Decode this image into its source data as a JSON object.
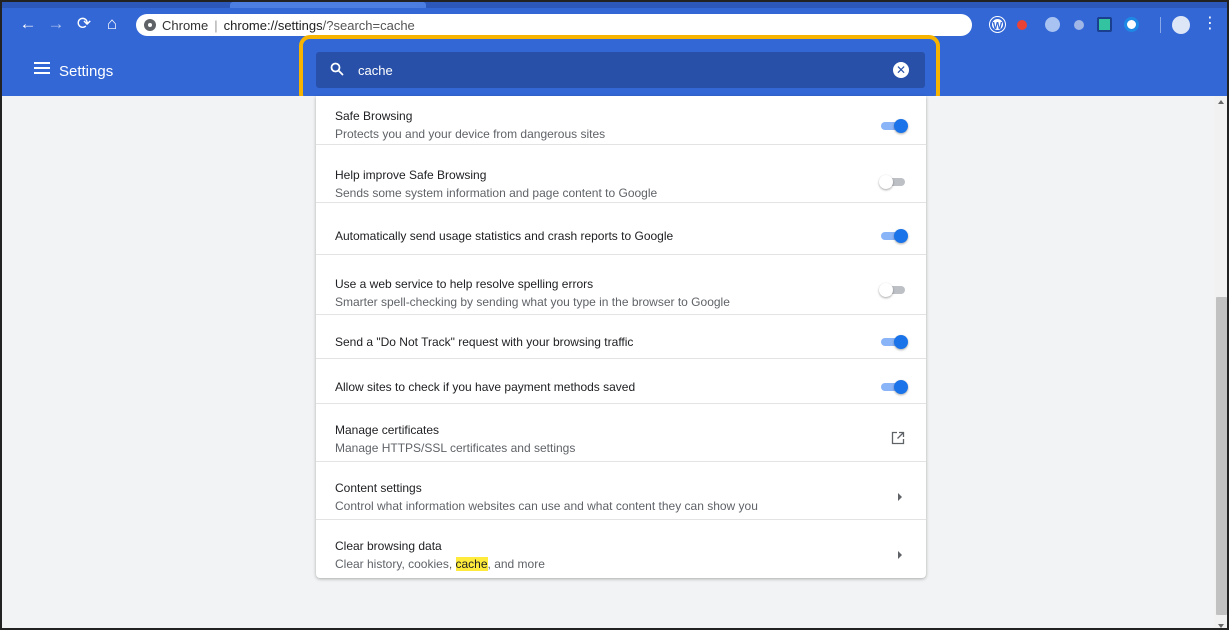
{
  "browser": {
    "omnibox": {
      "site_label": "Chrome",
      "separator": "|",
      "url_scheme_host": "chrome://settings",
      "url_rest": "/?search=cache"
    }
  },
  "header": {
    "title": "Settings"
  },
  "search": {
    "value": "cache"
  },
  "settings": {
    "safe_browsing": {
      "title": "Safe Browsing",
      "subtitle": "Protects you and your device from dangerous sites",
      "enabled": true
    },
    "help_improve": {
      "title": "Help improve Safe Browsing",
      "subtitle": "Sends some system information and page content to Google",
      "enabled": false
    },
    "usage_stats": {
      "title": "Automatically send usage statistics and crash reports to Google",
      "enabled": true
    },
    "spelling": {
      "title": "Use a web service to help resolve spelling errors",
      "subtitle": "Smarter spell-checking by sending what you type in the browser to Google",
      "enabled": false
    },
    "do_not_track": {
      "title": "Send a \"Do Not Track\" request with your browsing traffic",
      "enabled": true
    },
    "payment_methods": {
      "title": "Allow sites to check if you have payment methods saved",
      "enabled": true
    },
    "certificates": {
      "title": "Manage certificates",
      "subtitle": "Manage HTTPS/SSL certificates and settings"
    },
    "content_settings": {
      "title": "Content settings",
      "subtitle": "Control what information websites can use and what content they can show you"
    },
    "clear_data": {
      "title": "Clear browsing data",
      "subtitle_before": "Clear history, cookies, ",
      "subtitle_highlight": "cache",
      "subtitle_after": ", and more"
    }
  },
  "colors": {
    "toolbar": "#3367d6",
    "search_bg": "#2850a8",
    "highlight_ring": "#f6b400",
    "toggle_on": "#1a73e8",
    "match_highlight": "#ffeb3b"
  }
}
